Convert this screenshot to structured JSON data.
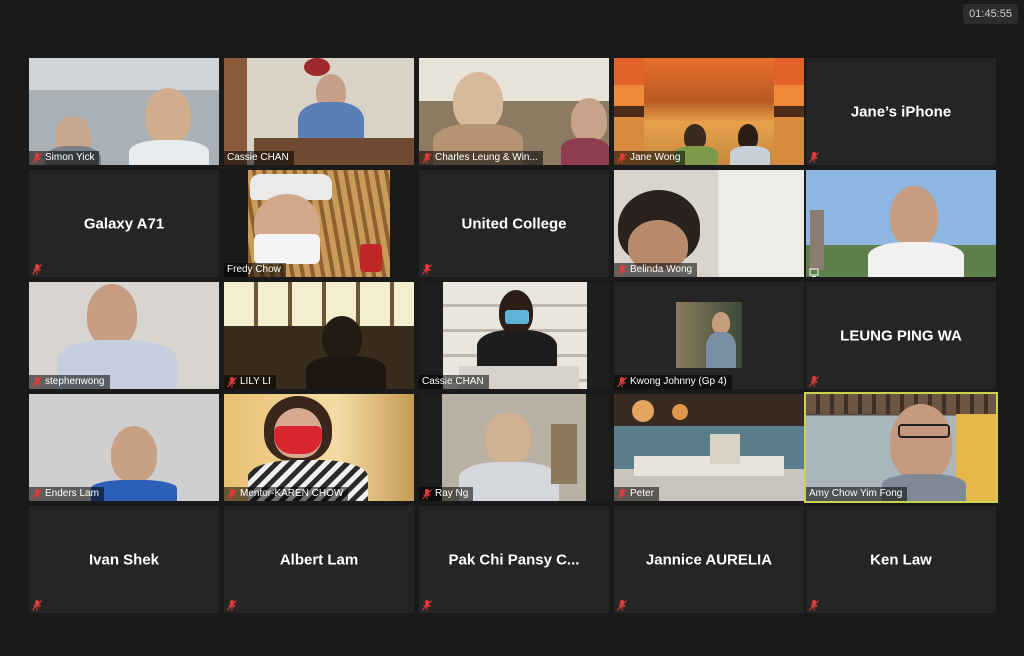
{
  "clock": "01:45:55",
  "colors": {
    "active_border": "#c9d34b",
    "muted_icon": "#e23b3b"
  },
  "tiles": [
    {
      "name": "Simon Yick",
      "type": "video",
      "muted": true
    },
    {
      "name": "Cassie CHAN",
      "type": "video",
      "muted": false
    },
    {
      "name": "Charles Leung & Win...",
      "type": "video",
      "muted": true
    },
    {
      "name": "Jane Wong",
      "type": "video",
      "muted": true
    },
    {
      "name": "Jane’s iPhone",
      "type": "name",
      "muted": true
    },
    {
      "name": "Galaxy A71",
      "type": "name",
      "muted": true
    },
    {
      "name": "Fredy Chow",
      "type": "video",
      "muted": false
    },
    {
      "name": "United College",
      "type": "name",
      "muted": true
    },
    {
      "name": "Belinda Wong",
      "type": "video",
      "muted": true
    },
    {
      "name": "",
      "type": "video",
      "muted": false,
      "icon": "screen-icon"
    },
    {
      "name": "stephenwong",
      "type": "video",
      "muted": true
    },
    {
      "name": "LILY LI",
      "type": "video",
      "muted": true
    },
    {
      "name": "Cassie CHAN",
      "type": "video",
      "muted": false
    },
    {
      "name": "Kwong Johnny (Gp 4)",
      "type": "photo",
      "muted": true
    },
    {
      "name": "LEUNG PING WA",
      "type": "name",
      "muted": true
    },
    {
      "name": "Enders Lam",
      "type": "video",
      "muted": true
    },
    {
      "name": "Mentor-KAREN CHOW",
      "type": "video",
      "muted": true
    },
    {
      "name": "Ray Ng",
      "type": "video",
      "muted": true
    },
    {
      "name": "Peter",
      "type": "video",
      "muted": true
    },
    {
      "name": "Amy Chow Yim Fong",
      "type": "video",
      "muted": false,
      "active": true
    },
    {
      "name": "Ivan Shek",
      "type": "name",
      "muted": true
    },
    {
      "name": "Albert Lam",
      "type": "name",
      "muted": true
    },
    {
      "name": "Pak Chi Pansy C...",
      "type": "name",
      "muted": true
    },
    {
      "name": "Jannice AURELIA",
      "type": "name",
      "muted": true
    },
    {
      "name": "Ken Law",
      "type": "name",
      "muted": true
    }
  ]
}
